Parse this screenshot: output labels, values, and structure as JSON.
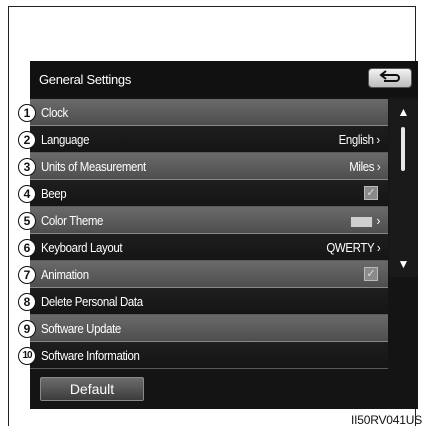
{
  "screen": {
    "title": "General Settings",
    "back_icon": "return-arrow-icon",
    "items": [
      {
        "label": "Clock",
        "value": "",
        "type": "link"
      },
      {
        "label": "Language",
        "value": "English",
        "type": "link"
      },
      {
        "label": "Units of Measurement",
        "value": "Miles",
        "type": "link"
      },
      {
        "label": "Beep",
        "value": "",
        "type": "checkbox",
        "checked": true
      },
      {
        "label": "Color Theme",
        "value": "",
        "type": "swatch"
      },
      {
        "label": "Keyboard Layout",
        "value": "QWERTY",
        "type": "link"
      },
      {
        "label": "Animation",
        "value": "",
        "type": "checkbox",
        "checked": true
      },
      {
        "label": "Delete Personal Data",
        "value": "",
        "type": "plain"
      },
      {
        "label": "Software Update",
        "value": "",
        "type": "plain"
      },
      {
        "label": "Software Information",
        "value": "",
        "type": "plain"
      }
    ],
    "chevron": "›",
    "scroll_up_icon": "▲",
    "scroll_down_icon": "▼",
    "default_label": "Default"
  },
  "callouts": [
    "1",
    "2",
    "3",
    "4",
    "5",
    "6",
    "7",
    "8",
    "9",
    "10"
  ],
  "figure_id": "II50RV041US",
  "colors": {
    "screen_bg": "#141414",
    "highlight_row": "#5e5e5e",
    "check_fill": "#8a8a8a"
  }
}
